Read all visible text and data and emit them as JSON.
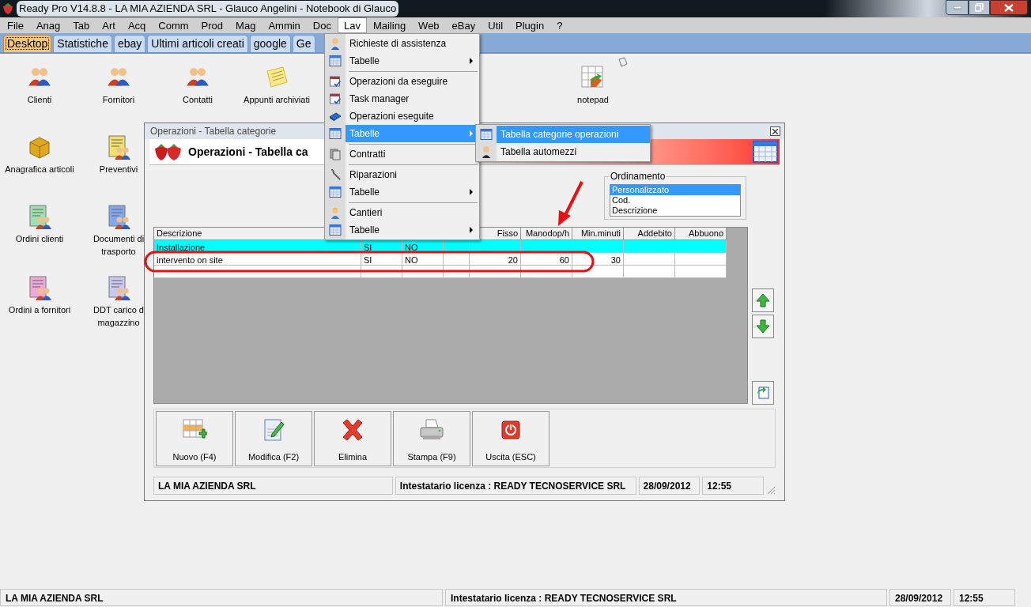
{
  "window": {
    "title": "Ready Pro V14.8.8 - LA MIA AZIENDA SRL - Glauco Angelini - Notebook di Glauco"
  },
  "menu_bar": [
    {
      "label": "File",
      "selected": false
    },
    {
      "label": "Anag",
      "selected": false
    },
    {
      "label": "Tab",
      "selected": false
    },
    {
      "label": "Art",
      "selected": false
    },
    {
      "label": "Acq",
      "selected": false
    },
    {
      "label": "Comm",
      "selected": false
    },
    {
      "label": "Prod",
      "selected": false
    },
    {
      "label": "Mag",
      "selected": false
    },
    {
      "label": "Ammin",
      "selected": false
    },
    {
      "label": "Doc",
      "selected": false
    },
    {
      "label": "Lav",
      "selected": true
    },
    {
      "label": "Mailing",
      "selected": false
    },
    {
      "label": "Web",
      "selected": false
    },
    {
      "label": "eBay",
      "selected": false
    },
    {
      "label": "Util",
      "selected": false
    },
    {
      "label": "Plugin",
      "selected": false
    },
    {
      "label": "?",
      "selected": false
    }
  ],
  "tabs": [
    {
      "label": "Desktop",
      "selected": true
    },
    {
      "label": "Statistiche",
      "selected": false
    },
    {
      "label": "ebay",
      "selected": false
    },
    {
      "label": "Ultimi articoli creati",
      "selected": false
    },
    {
      "label": "google",
      "selected": false
    },
    {
      "label": "Ge",
      "selected": false
    }
  ],
  "desktop_icons": [
    {
      "kind": "people",
      "lines": [
        "Clienti"
      ]
    },
    {
      "kind": "people",
      "lines": [
        "Fornitori"
      ]
    },
    {
      "kind": "people",
      "lines": [
        "Contatti"
      ]
    },
    {
      "kind": "note",
      "lines": [
        "Appunti archiviati"
      ]
    },
    {
      "kind": "grid",
      "lines": [
        "notepad"
      ]
    },
    {
      "kind": "box",
      "lines": [
        "Anagrafica articoli"
      ]
    },
    {
      "kind": "doc",
      "lines": [
        "Preventivi"
      ]
    },
    {
      "kind": "doc",
      "lines": [
        "Ordini clienti"
      ]
    },
    {
      "kind": "doc",
      "lines": [
        "Documenti di",
        "trasporto"
      ]
    },
    {
      "kind": "doc",
      "lines": [
        "Ordini a fornitori"
      ]
    },
    {
      "kind": "doc",
      "lines": [
        "DDT carico d",
        "magazzino"
      ]
    }
  ],
  "dialog": {
    "title": "Operazioni - Tabella categorie",
    "heading": "Operazioni - Tabella ca",
    "ordinamento": {
      "label": "Ordinamento",
      "options": [
        {
          "label": "Personalizzato",
          "selected": true
        },
        {
          "label": "Cod.",
          "selected": false
        },
        {
          "label": "Descrizione",
          "selected": false
        }
      ]
    },
    "table": {
      "columns": [
        "Descrizione",
        "Fisso",
        "Manodop/h",
        "Min.minuti",
        "Addebito",
        "Abbuono"
      ],
      "rows": [
        {
          "selected": true,
          "descrizione": "Installazione",
          "column_2": "SI",
          "column_3": "NO"
        },
        {
          "selected": false,
          "descrizione": "intervento on site",
          "column_2": "SI",
          "column_3": "NO",
          "fisso": "20",
          "manodop_h": "60",
          "min_minuti": "30"
        }
      ]
    },
    "buttons": [
      {
        "kind": "new",
        "label": "Nuovo (F4)"
      },
      {
        "kind": "edit",
        "label": "Modifica (F2)"
      },
      {
        "kind": "delete",
        "label": "Elimina"
      },
      {
        "kind": "print",
        "label": "Stampa (F9)"
      },
      {
        "kind": "exit",
        "label": "Uscita (ESC)"
      }
    ],
    "status_bar": [
      "LA MIA AZIENDA SRL",
      "Intestatario licenza : READY TECNOSERVICE SRL",
      "28/09/2012",
      "12:55"
    ]
  },
  "lav_menu": [
    {
      "kind": "item",
      "label": "Richieste di assistenza",
      "selected": false
    },
    {
      "kind": "submenu",
      "label": "Tabelle",
      "selected": false
    },
    {
      "kind": "separator"
    },
    {
      "kind": "item",
      "label": "Operazioni da eseguire",
      "selected": false
    },
    {
      "kind": "item",
      "label": "Task manager",
      "selected": false
    },
    {
      "kind": "item",
      "label": "Operazioni eseguite",
      "selected": false
    },
    {
      "kind": "submenu",
      "label": "Tabelle",
      "selected": true
    },
    {
      "kind": "separator"
    },
    {
      "kind": "item",
      "label": "Contratti",
      "selected": false
    },
    {
      "kind": "separator"
    },
    {
      "kind": "item",
      "label": "Riparazioni",
      "selected": false
    },
    {
      "kind": "submenu",
      "label": "Tabelle",
      "selected": false
    },
    {
      "kind": "separator"
    },
    {
      "kind": "item",
      "label": "Cantieri",
      "selected": false
    },
    {
      "kind": "submenu",
      "label": "Tabelle",
      "selected": false
    }
  ],
  "submenu": [
    {
      "label": "Tabella categorie operazioni",
      "selected": true
    },
    {
      "label": "Tabella automezzi",
      "selected": false
    }
  ],
  "status_bar": [
    "LA MIA AZIENDA SRL",
    "Intestatario licenza : READY TECNOSERVICE SRL",
    "28/09/2012",
    "12:55"
  ]
}
